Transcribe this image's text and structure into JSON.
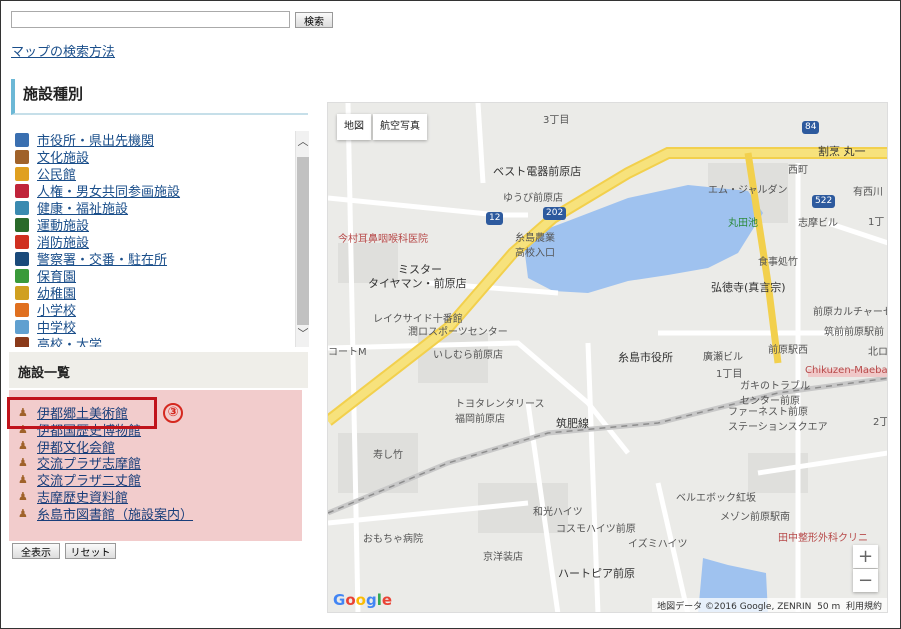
{
  "search": {
    "value": "",
    "button_label": "検索"
  },
  "howto_link": "マップの検索方法",
  "category_section": {
    "heading": "施設種別",
    "items": [
      {
        "label": "市役所・県出先機関",
        "icon": "building-icon",
        "color": "#3a6fb0"
      },
      {
        "label": "文化施設",
        "icon": "culture-icon",
        "color": "#a0622a"
      },
      {
        "label": "公民館",
        "icon": "community-hall-icon",
        "color": "#e0a020"
      },
      {
        "label": "人権・男女共同参画施設",
        "icon": "heart-icon",
        "color": "#c0243a"
      },
      {
        "label": "健康・福祉施設",
        "icon": "health-icon",
        "color": "#3a8ab0"
      },
      {
        "label": "運動施設",
        "icon": "sports-icon",
        "color": "#2a6a2a"
      },
      {
        "label": "消防施設",
        "icon": "fire-icon",
        "color": "#d03020"
      },
      {
        "label": "警察署・交番・駐在所",
        "icon": "police-icon",
        "color": "#1a4a7a"
      },
      {
        "label": "保育園",
        "icon": "nursery-icon",
        "color": "#3a9a3a"
      },
      {
        "label": "幼稚園",
        "icon": "kindergarten-icon",
        "color": "#d0a020"
      },
      {
        "label": "小学校",
        "icon": "elementary-school-icon",
        "color": "#e07020"
      },
      {
        "label": "中学校",
        "icon": "junior-high-icon",
        "color": "#60a0d0"
      },
      {
        "label": "高校・大学",
        "icon": "university-icon",
        "color": "#8a3a1a"
      }
    ]
  },
  "list_section": {
    "heading": "施設一覧",
    "items": [
      "伊都郷土美術館",
      "伊都国歴史博物館",
      "伊都文化会館",
      "交流プラザ志摩館",
      "交流プラザ二丈館",
      "志摩歴史資料館",
      "糸島市図書館（施設案内）"
    ],
    "highlight_marker": "③"
  },
  "buttons": {
    "show_all": "全表示",
    "reset": "リセット"
  },
  "map": {
    "type_buttons": [
      "地図",
      "航空写真"
    ],
    "labels": [
      {
        "text": "3丁目",
        "cls": ""
      },
      {
        "text": "ベスト電器前原店",
        "cls": "dark"
      },
      {
        "text": "ゆうび前原店",
        "cls": ""
      },
      {
        "text": "今村耳鼻咽喉科医院",
        "cls": "red"
      },
      {
        "text": "糸島農業\n高校入口",
        "cls": ""
      },
      {
        "text": "ミスター",
        "cls": "dark"
      },
      {
        "text": "タイヤマン・前原店",
        "cls": "dark"
      },
      {
        "text": "レイクサイド十番館",
        "cls": ""
      },
      {
        "text": "潤ロスポーツセンター",
        "cls": ""
      },
      {
        "text": "いしむら前原店",
        "cls": ""
      },
      {
        "text": "糸島市役所",
        "cls": "dark"
      },
      {
        "text": "トヨタレンタリース\n福岡前原店",
        "cls": ""
      },
      {
        "text": "筑肥線",
        "cls": "dark"
      },
      {
        "text": "寿し竹",
        "cls": ""
      },
      {
        "text": "丸田池",
        "cls": "green"
      },
      {
        "text": "弘徳寺(真言宗)",
        "cls": "dark"
      },
      {
        "text": "エム・ジャルダン",
        "cls": ""
      },
      {
        "text": "志摩ビル",
        "cls": ""
      },
      {
        "text": "食事処竹",
        "cls": ""
      },
      {
        "text": "割烹 丸一",
        "cls": "dark"
      },
      {
        "text": "西町",
        "cls": ""
      },
      {
        "text": "前原カルチャーセンター",
        "cls": ""
      },
      {
        "text": "筑前前原駅前",
        "cls": ""
      },
      {
        "text": "前原駅西",
        "cls": ""
      },
      {
        "text": "Chikuzen-Maebaru",
        "cls": "red"
      },
      {
        "text": "ガキのトラブル\nセンター前原",
        "cls": ""
      },
      {
        "text": "ファーネスト前原\nステーションスクエア",
        "cls": ""
      },
      {
        "text": "ベルエボック紅坂",
        "cls": ""
      },
      {
        "text": "メゾン前原駅南",
        "cls": ""
      },
      {
        "text": "田中整形外科クリニ",
        "cls": "red"
      },
      {
        "text": "コスモハイツ前原",
        "cls": ""
      },
      {
        "text": "イズミハイツ",
        "cls": ""
      },
      {
        "text": "ハートピア前原",
        "cls": "dark"
      },
      {
        "text": "おもちゃ病院",
        "cls": ""
      },
      {
        "text": "京洋装店",
        "cls": ""
      },
      {
        "text": "和光ハイツ",
        "cls": ""
      },
      {
        "text": "1丁目",
        "cls": ""
      },
      {
        "text": "廣瀬ビル",
        "cls": ""
      },
      {
        "text": "北ロ",
        "cls": ""
      },
      {
        "text": "有西川",
        "cls": ""
      },
      {
        "text": "1丁",
        "cls": ""
      },
      {
        "text": "2丁",
        "cls": ""
      },
      {
        "text": "コートM",
        "cls": ""
      }
    ],
    "route_badges": [
      "202",
      "12",
      "84",
      "522"
    ],
    "attribution": "地図データ ©2016 Google, ZENRIN",
    "scale_label": "50 m",
    "terms": "利用規約",
    "google_logo": "Google",
    "zoom_in": "+",
    "zoom_out": "−"
  }
}
